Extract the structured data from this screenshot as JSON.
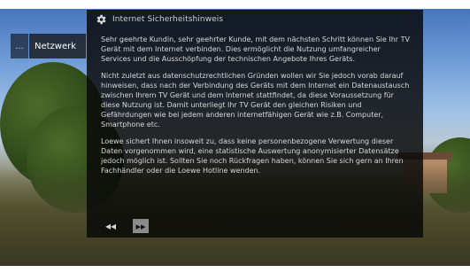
{
  "dialog": {
    "title": "Internet Sicherheitshinweis",
    "icon": "gear-icon",
    "paragraphs": [
      "Sehr geehrte Kundin, sehr geehrter Kunde, mit dem nächsten Schritt können Sie Ihr TV Gerät mit dem Internet verbinden. Dies ermöglicht die Nutzung umfangreicher Services und die Ausschöpfung der technischen Angebote Ihres Geräts.",
      "Nicht zuletzt aus datenschutzrechtlichen Gründen wollen wir Sie jedoch vorab darauf hinweisen, dass nach der Verbindung des Geräts mit dem Internet ein Datenaustausch zwischen Ihrem TV Gerät und dem Internet stattfindet, da diese Voraussetzung für diese Nutzung ist. Damit unterliegt Ihr TV Gerät den gleichen Risiken und Gefährdungen wie bei jedem anderen internetfähigen Gerät wie z.B. Computer, Smartphone etc.",
      "Loewe sichert Ihnen insoweit zu, dass keine personenbezogene Verwertung dieser Daten vorgenommen wird, eine statistische Auswertung anonymisierter Datensätze jedoch möglich ist. Sollten Sie noch Rückfragen haben, können Sie sich gern an Ihren Fachhändler oder die Loewe Hotline wenden."
    ],
    "footer": {
      "back_symbol": "◂◂",
      "next_symbol": "▸▸"
    }
  },
  "menu": {
    "left_symbol": "...",
    "nav_label": "Netzwerk"
  }
}
